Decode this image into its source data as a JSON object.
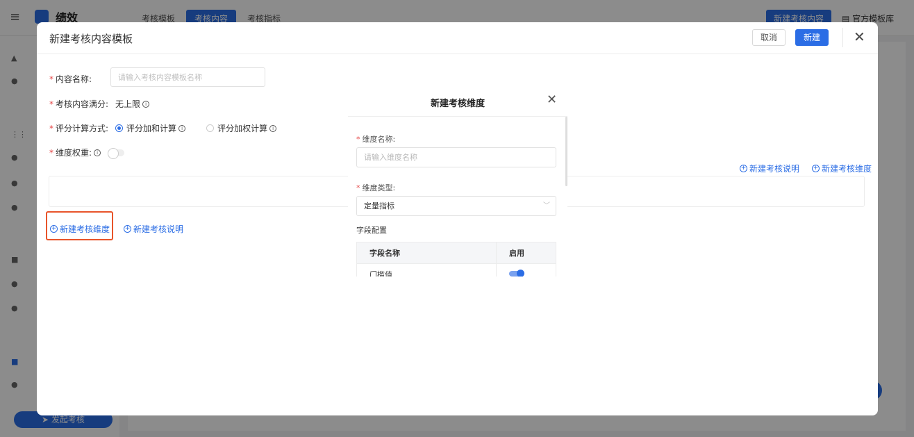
{
  "app": {
    "title": "绩效",
    "tabs": [
      "考核模板",
      "考核内容",
      "考核指标"
    ],
    "active_tab": 1,
    "new_content_button": "新建考核内容",
    "official_templates_link": "官方模板库",
    "launch_button": "发起考核"
  },
  "drawer": {
    "title": "新建考核内容模板",
    "cancel_label": "取消",
    "create_label": "新建",
    "name_label": "内容名称:",
    "name_placeholder": "请输入考核内容模板名称",
    "full_score_label": "考核内容满分:",
    "full_score_value": "无上限",
    "calc_label": "评分计算方式:",
    "calc_options": [
      "评分加和计算",
      "评分加权计算"
    ],
    "calc_selected": 0,
    "weight_label": "维度权重:",
    "add_description": "新建考核说明",
    "add_dimension": "新建考核维度"
  },
  "modal": {
    "title": "新建考核维度",
    "name_label": "维度名称:",
    "name_placeholder": "请输入维度名称",
    "type_label": "维度类型:",
    "type_value": "定量指标",
    "field_config_label": "字段配置",
    "table": {
      "headers": [
        "字段名称",
        "启用"
      ],
      "rows": [
        {
          "name": "门槛值",
          "enabled": true
        }
      ]
    }
  }
}
